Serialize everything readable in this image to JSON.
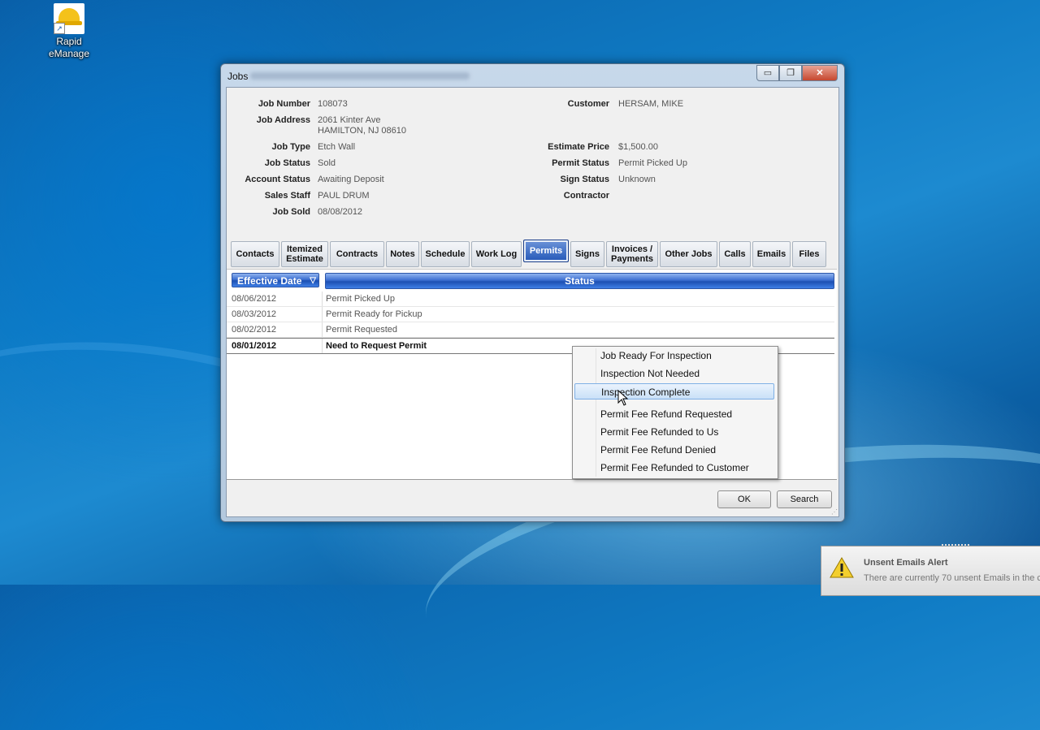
{
  "desktop": {
    "icon_label_line1": "Rapid",
    "icon_label_line2": "eManage"
  },
  "window": {
    "title": "Jobs",
    "buttons": {
      "minimize": "▭",
      "maximize": "❐",
      "close": "✕"
    }
  },
  "job_info": {
    "left": [
      {
        "label": "Job Number",
        "value": "108073"
      },
      {
        "label": "Job Address",
        "value": "2061 Kinter Ave",
        "value2": "HAMILTON,  NJ 08610"
      },
      {
        "label": "Job Type",
        "value": "Etch Wall"
      },
      {
        "label": "Job Status",
        "value": "Sold"
      },
      {
        "label": "Account Status",
        "value": "Awaiting Deposit"
      },
      {
        "label": "Sales Staff",
        "value": "PAUL DRUM"
      },
      {
        "label": "Job Sold",
        "value": "08/08/2012"
      }
    ],
    "right": [
      {
        "label": "Customer",
        "value": "HERSAM, MIKE"
      },
      {
        "label": "Estimate Price",
        "value": "$1,500.00"
      },
      {
        "label": "Permit Status",
        "value": "Permit Picked Up"
      },
      {
        "label": "Sign Status",
        "value": "Unknown"
      },
      {
        "label": "Contractor",
        "value": ""
      }
    ]
  },
  "tabs": [
    {
      "label": "Contacts"
    },
    {
      "label": "Itemized",
      "label2": "Estimate"
    },
    {
      "label": "Contracts"
    },
    {
      "label": "Notes"
    },
    {
      "label": "Schedule"
    },
    {
      "label": "Work Log"
    },
    {
      "label": "Permits",
      "active": true
    },
    {
      "label": "Signs"
    },
    {
      "label": "Invoices /",
      "label2": "Payments"
    },
    {
      "label": "Other Jobs"
    },
    {
      "label": "Calls"
    },
    {
      "label": "Emails"
    },
    {
      "label": "Files"
    }
  ],
  "grid": {
    "headers": {
      "effective_date": "Effective Date",
      "status": "Status",
      "sort_indicator": "▽"
    },
    "rows": [
      {
        "date": "08/06/2012",
        "status": "Permit Picked Up"
      },
      {
        "date": "08/03/2012",
        "status": "Permit Ready for Pickup"
      },
      {
        "date": "08/02/2012",
        "status": "Permit Requested"
      },
      {
        "date": "08/01/2012",
        "status": "Need to Request Permit",
        "bold": true
      }
    ]
  },
  "context_menu": {
    "items": [
      "Job Ready For Inspection",
      "Inspection Not Needed",
      "Inspection Complete",
      "Permit Fee Refund Requested",
      "Permit Fee Refunded to Us",
      "Permit Fee Refund Denied",
      "Permit Fee Refunded to Customer"
    ],
    "highlighted": "Inspection Complete"
  },
  "footer_buttons": {
    "ok": "OK",
    "search": "Search"
  },
  "notification": {
    "title": "Unsent Emails Alert",
    "body": "There are currently 70 unsent Emails in the c"
  },
  "colors": {
    "tab_active": "#2458b8",
    "grid_header": "#1c4fb2",
    "menu_highlight": "#c9e0f7"
  }
}
